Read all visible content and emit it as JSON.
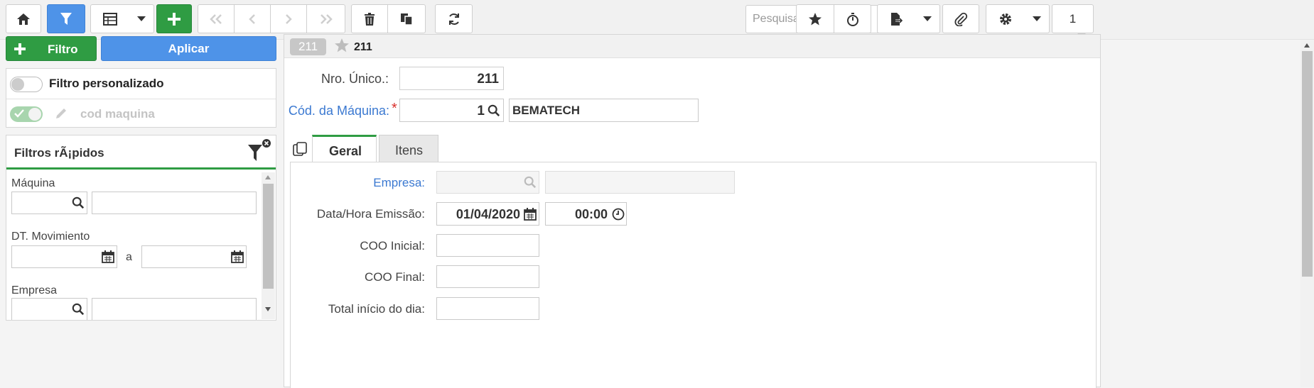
{
  "toolbar": {
    "search_placeholder": "Pesquisar registros...",
    "page_number": "1"
  },
  "left": {
    "add_filter_label": "Filtro",
    "apply_label": "Aplicar",
    "custom_filter_label": "Filtro personalizado",
    "saved_filter_label": "cod maquina",
    "quick_filters_title": "Filtros rÃ¡pidos",
    "field_machine": "Máquina",
    "field_date": "DT. Movimiento",
    "date_separator": "a",
    "field_company": "Empresa"
  },
  "record": {
    "badge": "211",
    "title": "211",
    "unique_label": "Nro. Único.:",
    "unique_value": "211",
    "machine_label": "Cód. da Máquina:",
    "required_mark": "*",
    "machine_code": "1",
    "machine_desc": "BEMATECH"
  },
  "tabs": [
    {
      "label": "Geral",
      "active": true
    },
    {
      "label": "Itens",
      "active": false
    }
  ],
  "form": {
    "company_label": "Empresa:",
    "datetime_label": "Data/Hora Emissão:",
    "date_value": "01/04/2020",
    "time_value": "00:00",
    "coo_start_label": "COO Inicial:",
    "coo_end_label": "COO Final:",
    "total_start_label": "Total início do dia:"
  },
  "colors": {
    "accent_blue": "#4e93e8",
    "accent_green": "#2f9c43",
    "link_blue": "#3b79d1",
    "required_red": "#d9302c"
  }
}
